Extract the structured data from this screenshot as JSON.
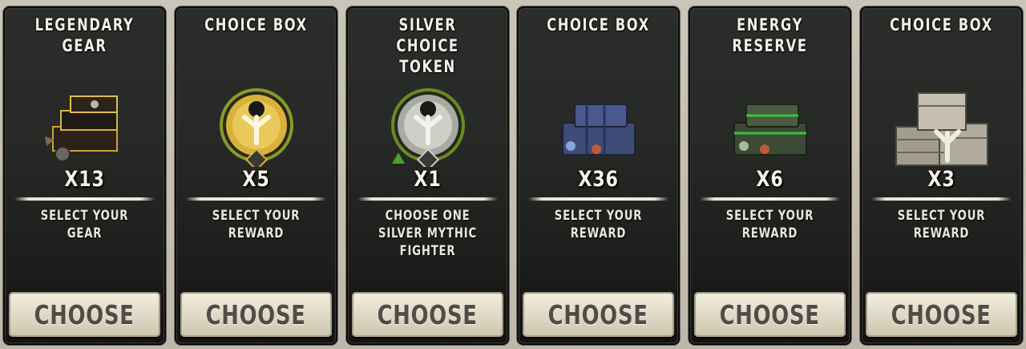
{
  "cards": [
    {
      "title": "LEGENDARY GEAR",
      "count": "X13",
      "description": "SELECT YOUR GEAR",
      "button": "CHOOSE",
      "icon": "legendary-gear-crate-icon"
    },
    {
      "title": "CHOICE BOX",
      "count": "X5",
      "description": "SELECT YOUR REWARD",
      "button": "CHOOSE",
      "icon": "gold-choice-medallion-icon"
    },
    {
      "title": "SILVER CHOICE TOKEN",
      "count": "X1",
      "description": "CHOOSE ONE SILVER MYTHIC FIGHTER",
      "button": "CHOOSE",
      "icon": "silver-choice-medallion-icon"
    },
    {
      "title": "CHOICE BOX",
      "count": "X36",
      "description": "SELECT YOUR REWARD",
      "button": "CHOOSE",
      "icon": "blue-crates-icon"
    },
    {
      "title": "ENERGY RESERVE",
      "count": "X6",
      "description": "SELECT YOUR REWARD",
      "button": "CHOOSE",
      "icon": "green-crates-icon"
    },
    {
      "title": "CHOICE BOX",
      "count": "X3",
      "description": "SELECT YOUR REWARD",
      "button": "CHOOSE",
      "icon": "wooden-crates-icon"
    }
  ]
}
